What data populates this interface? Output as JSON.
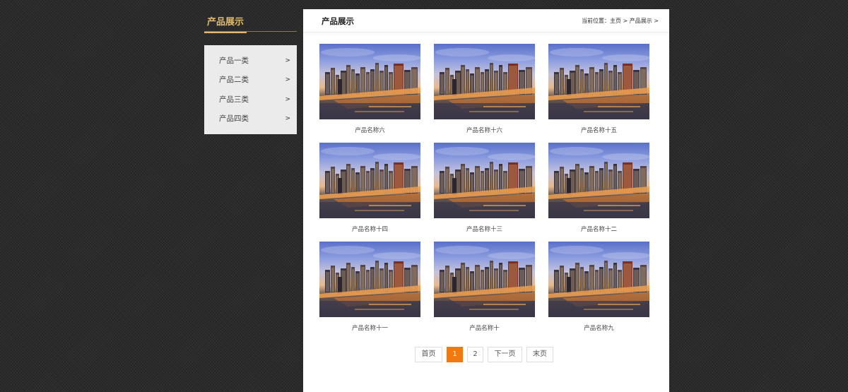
{
  "sidebar": {
    "title": "产品展示",
    "accent_color": "#e0b96b",
    "items": [
      {
        "label": "产品一类",
        "arrow": ">"
      },
      {
        "label": "产品二类",
        "arrow": ">"
      },
      {
        "label": "产品三类",
        "arrow": ">"
      },
      {
        "label": "产品四类",
        "arrow": ">"
      }
    ]
  },
  "panel": {
    "title": "产品展示",
    "breadcrumb": {
      "prefix": "当前位置：",
      "home": "主页",
      "sep1": " > ",
      "current": "产品展示",
      "sep2": " >"
    }
  },
  "products": [
    {
      "name": "产品名称六"
    },
    {
      "name": "产品名称十六"
    },
    {
      "name": "产品名称十五"
    },
    {
      "name": "产品名称十四"
    },
    {
      "name": "产品名称十三"
    },
    {
      "name": "产品名称十二"
    },
    {
      "name": "产品名称十一"
    },
    {
      "name": "产品名称十"
    },
    {
      "name": "产品名称九"
    }
  ],
  "pagination": {
    "first": "首页",
    "pages": [
      "1",
      "2"
    ],
    "current_page": "1",
    "next": "下一页",
    "last": "末页",
    "active_color": "#f07a10"
  }
}
